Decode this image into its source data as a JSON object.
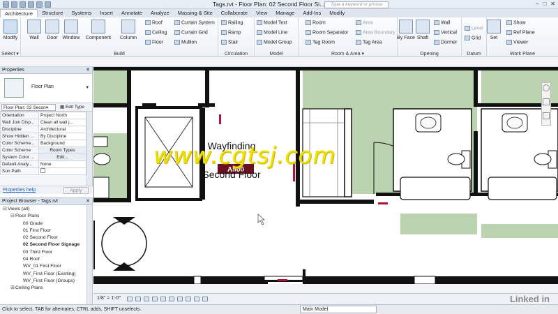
{
  "window": {
    "title": "Tags.rvt - Floor Plan: 02 Second Floor Si...",
    "search_placeholder": "Type a keyword or phrase"
  },
  "ribbon_tabs": [
    "Architecture",
    "Structure",
    "Systems",
    "Insert",
    "Annotate",
    "Analyze",
    "Massing & Site",
    "Collaborate",
    "View",
    "Manage",
    "Add-Ins",
    "Modify"
  ],
  "ribbon": {
    "select": {
      "modify": "Modify",
      "label": "Select ▾"
    },
    "build": {
      "label": "Build",
      "wall": "Wall",
      "door": "Door",
      "window": "Window",
      "component": "Component",
      "column": "Column",
      "roof": "Roof",
      "ceiling": "Ceiling",
      "floor": "Floor",
      "curtain_system": "Curtain System",
      "curtain_grid": "Curtain Grid",
      "mullion": "Mullion"
    },
    "circulation": {
      "label": "Circulation",
      "railing": "Railing",
      "ramp": "Ramp",
      "stair": "Stair"
    },
    "model": {
      "label": "Model",
      "model_text": "Model  Text",
      "model_line": "Model  Line",
      "model_group": "Model  Group"
    },
    "room_area": {
      "label": "Room & Area ▾",
      "room": "Room",
      "room_separator": "Room  Separator",
      "tag_room": "Tag  Room",
      "area": "Area",
      "area_boundary": "Area  Boundary",
      "tag_area": "Tag  Area"
    },
    "opening": {
      "label": "Opening",
      "by_face": "By Face",
      "shaft": "Shaft",
      "wall": "Wall",
      "vertical": "Vertical",
      "dormer": "Dormer"
    },
    "datum": {
      "label": "Datum",
      "level": "Level",
      "grid": "Grid"
    },
    "work_plane": {
      "label": "Work Plane",
      "set": "Set",
      "show": "Show",
      "ref_plane": "Ref Plane",
      "viewer": "Viewer"
    }
  },
  "properties": {
    "header": "Properties",
    "type_name": "Floor Plan",
    "instance_selector": "Floor Plan: 02 Secon▾",
    "edit_type": "Edit Type",
    "rows": [
      {
        "k": "Orientation",
        "v": "Project North"
      },
      {
        "k": "Wall Join Disp...",
        "v": "Clean all wall j..."
      },
      {
        "k": "Discipline",
        "v": "Architectural"
      },
      {
        "k": "Show Hidden ...",
        "v": "By Discipline"
      },
      {
        "k": "Color Scheme...",
        "v": "Background"
      },
      {
        "k": "Color Scheme",
        "v": "Room Types"
      },
      {
        "k": "System Color ...",
        "v": "Edit..."
      },
      {
        "k": "Default Analy...",
        "v": "None"
      },
      {
        "k": "Sun Path",
        "v": ""
      }
    ],
    "help_link": "Properties help",
    "apply_button": "Apply"
  },
  "project_browser": {
    "header": "Project Browser - Tags.rvt",
    "nodes": [
      {
        "label": "Views (all)",
        "indent": 0,
        "toggle": "⊟"
      },
      {
        "label": "Floor Plans",
        "indent": 1,
        "toggle": "⊟"
      },
      {
        "label": "00 Grade",
        "indent": 2,
        "toggle": ""
      },
      {
        "label": "01 First Floor",
        "indent": 2,
        "toggle": ""
      },
      {
        "label": "02 Second Floor",
        "indent": 2,
        "toggle": ""
      },
      {
        "label": "02 Second Floor Signage",
        "indent": 2,
        "toggle": "",
        "bold": true
      },
      {
        "label": "03 Third Floor",
        "indent": 2,
        "toggle": ""
      },
      {
        "label": "04 Roof",
        "indent": 2,
        "toggle": ""
      },
      {
        "label": "WV_01 First Floor",
        "indent": 2,
        "toggle": ""
      },
      {
        "label": "WV_First Floor (Existing)",
        "indent": 2,
        "toggle": ""
      },
      {
        "label": "WV_First Floor (Groups)",
        "indent": 2,
        "toggle": ""
      },
      {
        "label": "Ceiling Plans",
        "indent": 1,
        "toggle": "⊞"
      }
    ]
  },
  "canvas": {
    "room_label_line1": "Wayfinding",
    "room_label_line2": "Second Floor",
    "tag_text": "A500"
  },
  "view_bar": {
    "scale": "1/8\" = 1'-0\""
  },
  "status_bar": {
    "message": "Click to select, TAB for alternates, CTRL adds, SHIFT unselects.",
    "model": "Main Model"
  },
  "overlay": {
    "watermark": "www.cgtsj.com",
    "brand": "Linked in"
  },
  "colors": {
    "room_fill": "#bcd3b0",
    "wall": "#111111",
    "tag_red": "#b0143a",
    "ribbon_bg": "#eef2f7"
  }
}
